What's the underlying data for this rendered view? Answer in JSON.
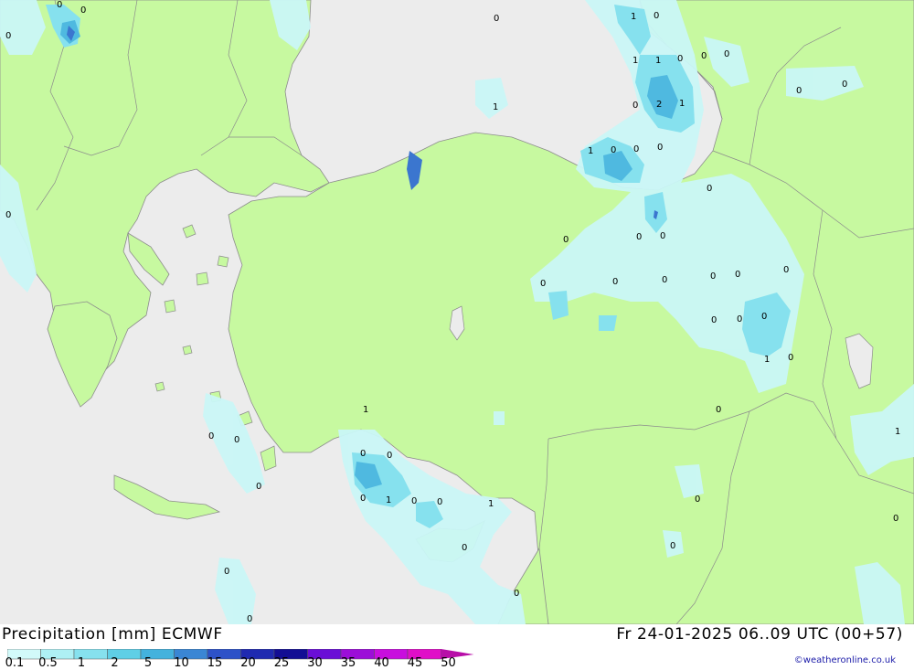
{
  "title": "Precipitation [mm] ECMWF",
  "datetime": "Fr 24-01-2025 06..09 UTC (00+57)",
  "credit": "©weatheronline.co.uk",
  "colors": {
    "sea": "#ececec",
    "land": "#c7f9a0",
    "border": "#8c8c8c",
    "precip_light": "#caf7f7",
    "precip_medium": "#86e1ee",
    "precip_heavy": "#4fb9e0",
    "precip_peak": "#3b76cf"
  },
  "legend": {
    "labels": [
      "0.1",
      "0.5",
      "1",
      "2",
      "5",
      "10",
      "15",
      "20",
      "25",
      "30",
      "35",
      "40",
      "45",
      "50"
    ],
    "colors": [
      "#d2fafa",
      "#aef0f4",
      "#86e1ee",
      "#5fcfe6",
      "#44b2dd",
      "#3a86d4",
      "#2d52c8",
      "#1f2ab0",
      "#130e94",
      "#6a0ed6",
      "#9c0ed8",
      "#c80ede",
      "#e00ec8",
      "#b80ea8"
    ]
  },
  "map": {
    "value_labels": [
      {
        "id": "v1",
        "text": "0"
      },
      {
        "id": "v2",
        "text": "0"
      },
      {
        "id": "v3",
        "text": "0"
      },
      {
        "id": "v4",
        "text": "0"
      },
      {
        "id": "v5",
        "text": "1"
      },
      {
        "id": "v6",
        "text": "0"
      },
      {
        "id": "v7",
        "text": "1"
      },
      {
        "id": "v8",
        "text": "1"
      },
      {
        "id": "v9",
        "text": "0"
      },
      {
        "id": "v10",
        "text": "0"
      },
      {
        "id": "v11",
        "text": "0"
      },
      {
        "id": "v12",
        "text": "0"
      },
      {
        "id": "v13",
        "text": "0"
      },
      {
        "id": "v14",
        "text": "2"
      },
      {
        "id": "v15",
        "text": "1"
      },
      {
        "id": "v16",
        "text": "1"
      },
      {
        "id": "v17",
        "text": "1"
      },
      {
        "id": "v18",
        "text": "0"
      },
      {
        "id": "v19",
        "text": "0"
      },
      {
        "id": "v20",
        "text": "0"
      },
      {
        "id": "v21",
        "text": "0"
      },
      {
        "id": "v22",
        "text": "0"
      },
      {
        "id": "v23",
        "text": "0"
      },
      {
        "id": "v24",
        "text": "0"
      },
      {
        "id": "v25",
        "text": "0"
      },
      {
        "id": "v26",
        "text": "0"
      },
      {
        "id": "v27",
        "text": "0"
      },
      {
        "id": "v28",
        "text": "0"
      },
      {
        "id": "v29",
        "text": "0"
      },
      {
        "id": "v30",
        "text": "0"
      },
      {
        "id": "v31",
        "text": "0"
      },
      {
        "id": "v32",
        "text": "0"
      },
      {
        "id": "v33",
        "text": "1"
      },
      {
        "id": "v34",
        "text": "0"
      },
      {
        "id": "v35",
        "text": "0"
      },
      {
        "id": "v36",
        "text": "0"
      },
      {
        "id": "v37",
        "text": "0"
      },
      {
        "id": "v38",
        "text": "1"
      },
      {
        "id": "v39",
        "text": "0"
      },
      {
        "id": "v40",
        "text": "0"
      },
      {
        "id": "v41",
        "text": "0"
      },
      {
        "id": "v42",
        "text": "1"
      },
      {
        "id": "v43",
        "text": "1"
      },
      {
        "id": "v44",
        "text": "0"
      },
      {
        "id": "v45",
        "text": "0"
      },
      {
        "id": "v46",
        "text": "0"
      },
      {
        "id": "v47",
        "text": "0"
      },
      {
        "id": "v48",
        "text": "0"
      },
      {
        "id": "v49",
        "text": "1"
      },
      {
        "id": "v50",
        "text": "0"
      },
      {
        "id": "v51",
        "text": "0"
      },
      {
        "id": "v52",
        "text": "0"
      }
    ]
  }
}
